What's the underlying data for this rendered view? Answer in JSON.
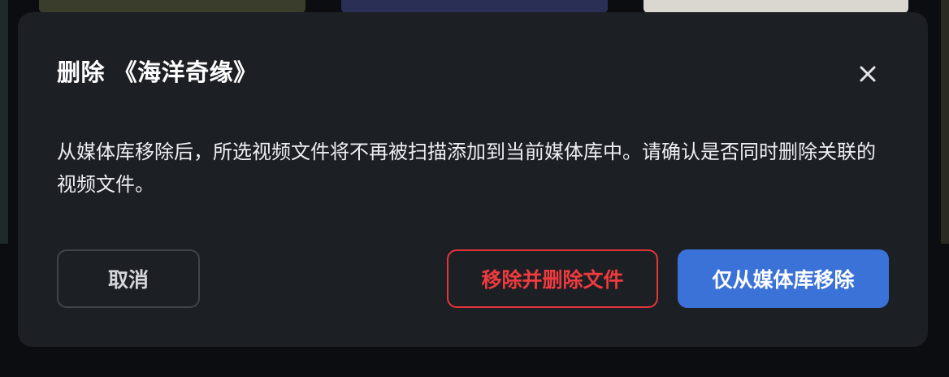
{
  "dialog": {
    "title": "删除 《海洋奇缘》",
    "message": "从媒体库移除后，所选视频文件将不再被扫描添加到当前媒体库中。请确认是否同时删除关联的视频文件。",
    "close_icon": "close-icon",
    "buttons": {
      "cancel": "取消",
      "remove_and_delete": "移除并删除文件",
      "remove_only": "仅从媒体库移除"
    }
  },
  "colors": {
    "dialog_bg": "#1c1f24",
    "danger": "#ee3b3f",
    "primary": "#3b72d8",
    "backdrop": "#0c0d10"
  }
}
